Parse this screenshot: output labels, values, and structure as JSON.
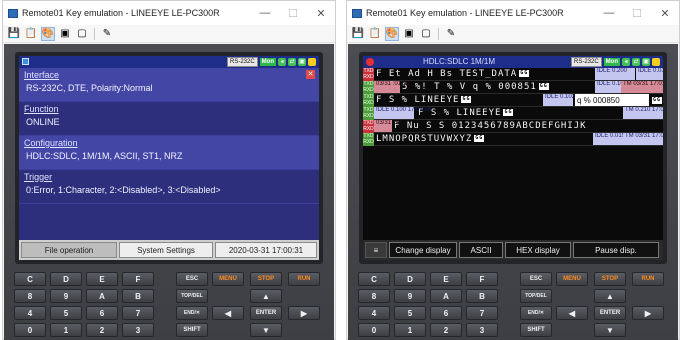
{
  "window": {
    "title": "Remote01 Key emulation - LINEEYE LE-PC300R",
    "minimize": "—",
    "maximize": "☐",
    "close": "✕"
  },
  "toolbar_icons": [
    "save-icon",
    "copy-icon",
    "color-icon",
    "layout-a-icon",
    "layout-b-icon",
    "tool-icon"
  ],
  "left_screen": {
    "badges": {
      "port": "RS-232C",
      "mode": "Mon"
    },
    "close_glyph": "✕",
    "menu": [
      {
        "heading": "Interface",
        "value": "RS-232C, DTE, Polarity:Normal"
      },
      {
        "heading": "Function",
        "value": "ONLINE"
      },
      {
        "heading": "Configuration",
        "value": "HDLC:SDLC, 1M/1M, ASCII, ST1, NRZ"
      },
      {
        "heading": "Trigger",
        "value": "0:Error, 1:Character, 2:<Disabled>, 3:<Disabled>"
      }
    ],
    "buttons": {
      "file_operation": "File operation",
      "system_settings": "System Settings",
      "datetime": "2020-03-31 17:00:31"
    }
  },
  "right_screen": {
    "title": "HDLC:SDLC 1M/1M",
    "badges": {
      "port": "RS-232C",
      "mode": "Mon"
    },
    "rows": [
      {
        "text": "F Et Ad H Bs TEST_DATA",
        "gtag": "GG",
        "box": "IDLE 0.200",
        "box2": "IDLE 0.0157"
      },
      {
        "text": "5 %! T % V q % 000851",
        "gtag": "GG",
        "pink": "03/31 :01:58",
        "box": "IDLE 0.100",
        "box2": "TM 03/31 17:01:58"
      },
      {
        "text": "F S %  LINEEYE",
        "gtag": "GG",
        "box": "IDLE 0.103",
        "white": "q % 000850",
        "gtag2": "GG"
      },
      {
        "text": "F S %  LINEEYE",
        "gtag": "GG",
        "box": "IDLE 0.100 17:01:58",
        "box2": "TM 0.210 17:0"
      },
      {
        "text": "F Nu S S 0123456789ABCDEFGHIJK",
        "pink": "03/31 :58"
      },
      {
        "text": "LMNOPQRSTUVWXYZ",
        "gtag": "GG",
        "box": "IDLE 0.019",
        "box2": "TM 03/31 17:01:58"
      }
    ],
    "buttons": {
      "menu": "≡",
      "change_display": "Change display",
      "ascii": "ASCII",
      "hex_display": "HEX display",
      "pause": "Pause disp."
    }
  },
  "keypad": {
    "row1": [
      "C",
      "D",
      "E",
      "F",
      "ESC",
      "MENU",
      "STOP",
      "RUN"
    ],
    "row2": [
      "8",
      "9",
      "A",
      "B",
      "TOP/DEL",
      "▲"
    ],
    "row3": [
      "4",
      "5",
      "6",
      "7",
      "END/✕",
      "◀",
      "ENTER",
      "▶"
    ],
    "row4": [
      "0",
      "1",
      "2",
      "3",
      "SHIFT",
      "▼"
    ]
  },
  "colors": {
    "screen_bg": "#2d2f7c",
    "accent_orange": "#ff8a1e",
    "rx_green": "#4d9b3a",
    "tx_red": "#c8303a"
  }
}
